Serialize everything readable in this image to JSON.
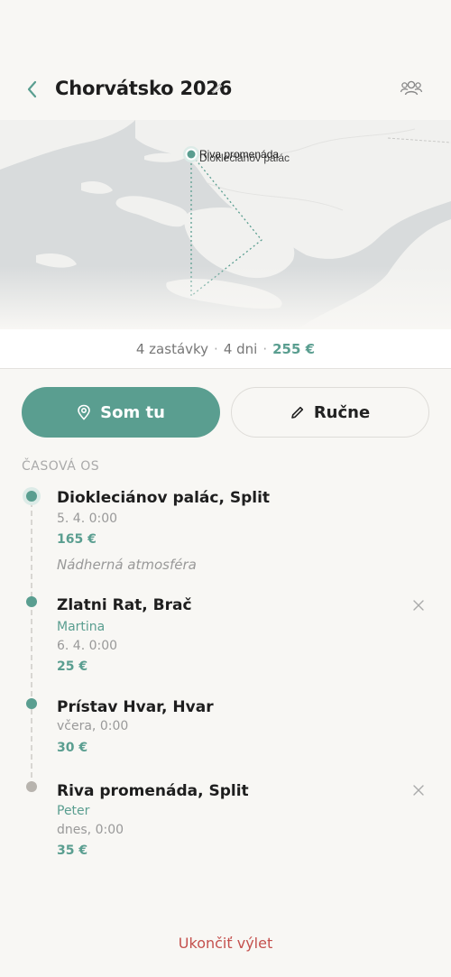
{
  "header": {
    "title": "Chorvátsko 2026",
    "icons": {
      "back": "back-chevron-icon",
      "edit": "pencil-icon",
      "group": "group-icon"
    }
  },
  "map": {
    "labels": [
      "Riva promenáda",
      "Diokleciánov palác"
    ]
  },
  "summary": {
    "stops": "4 zastávky",
    "days": "4 dni",
    "price": "255 €"
  },
  "actions": {
    "here_label": "Som tu",
    "manual_label": "Ručne"
  },
  "timeline": {
    "label": "ČASOVÁ OS",
    "stops": [
      {
        "name": "Diokleciánov palác, Split",
        "date": "5. 4. 0:00",
        "price": "165 €",
        "note": "Nádherná atmosféra"
      },
      {
        "name": "Zlatni Rat, Brač",
        "person": "Martina",
        "date": "6. 4. 0:00",
        "price": "25 €"
      },
      {
        "name": "Prístav Hvar, Hvar",
        "date": "včera, 0:00",
        "price": "30 €"
      },
      {
        "name": "Riva promenáda, Split",
        "person": "Peter",
        "date": "dnes, 0:00",
        "price": "35 €"
      }
    ]
  },
  "footer": {
    "end_trip": "Ukončiť výlet"
  },
  "colors": {
    "accent": "#5a9e90",
    "danger": "#c4504d",
    "background": "#f8f7f4"
  }
}
